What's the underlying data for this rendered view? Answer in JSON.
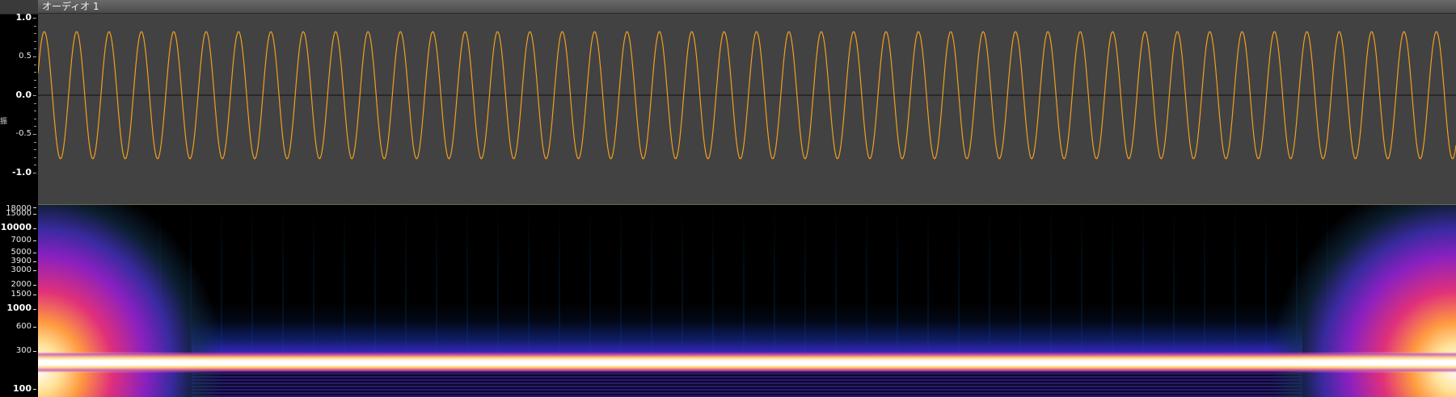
{
  "track": {
    "title": "オーディオ 1"
  },
  "amplitude_axis": {
    "unit_label": "振",
    "ticks": [
      {
        "label": "1.0",
        "value": 1.0,
        "bold": true
      },
      {
        "label": "0.5",
        "value": 0.5,
        "bold": false
      },
      {
        "label": "0.0",
        "value": 0.0,
        "bold": true
      },
      {
        "label": "-0.5",
        "value": -0.5,
        "bold": false
      },
      {
        "label": "-1.0",
        "value": -1.0,
        "bold": true
      }
    ]
  },
  "frequency_axis": {
    "ticks": [
      {
        "label": "18000",
        "value": 18000,
        "bold": false
      },
      {
        "label": "15000",
        "value": 15000,
        "bold": false
      },
      {
        "label": "10000",
        "value": 10000,
        "bold": true
      },
      {
        "label": "7000",
        "value": 7000,
        "bold": false
      },
      {
        "label": "5000",
        "value": 5000,
        "bold": false
      },
      {
        "label": "3900",
        "value": 3900,
        "bold": false
      },
      {
        "label": "3000",
        "value": 3000,
        "bold": false
      },
      {
        "label": "2000",
        "value": 2000,
        "bold": false
      },
      {
        "label": "1500",
        "value": 1500,
        "bold": false
      },
      {
        "label": "1000",
        "value": 1000,
        "bold": true
      },
      {
        "label": "600",
        "value": 600,
        "bold": false
      },
      {
        "label": "300",
        "value": 300,
        "bold": false
      },
      {
        "label": "100",
        "value": 100,
        "bold": true
      }
    ]
  },
  "waveform": {
    "cycles": 43.8,
    "amplitude": 0.82,
    "color": "#f0a020",
    "background": "#424242",
    "zero_line_color": "#101010"
  },
  "colors": {
    "titlebar_text": "#f0f0f0",
    "axis_text": "#e8e8e8",
    "divider": "#6c6a4a"
  }
}
